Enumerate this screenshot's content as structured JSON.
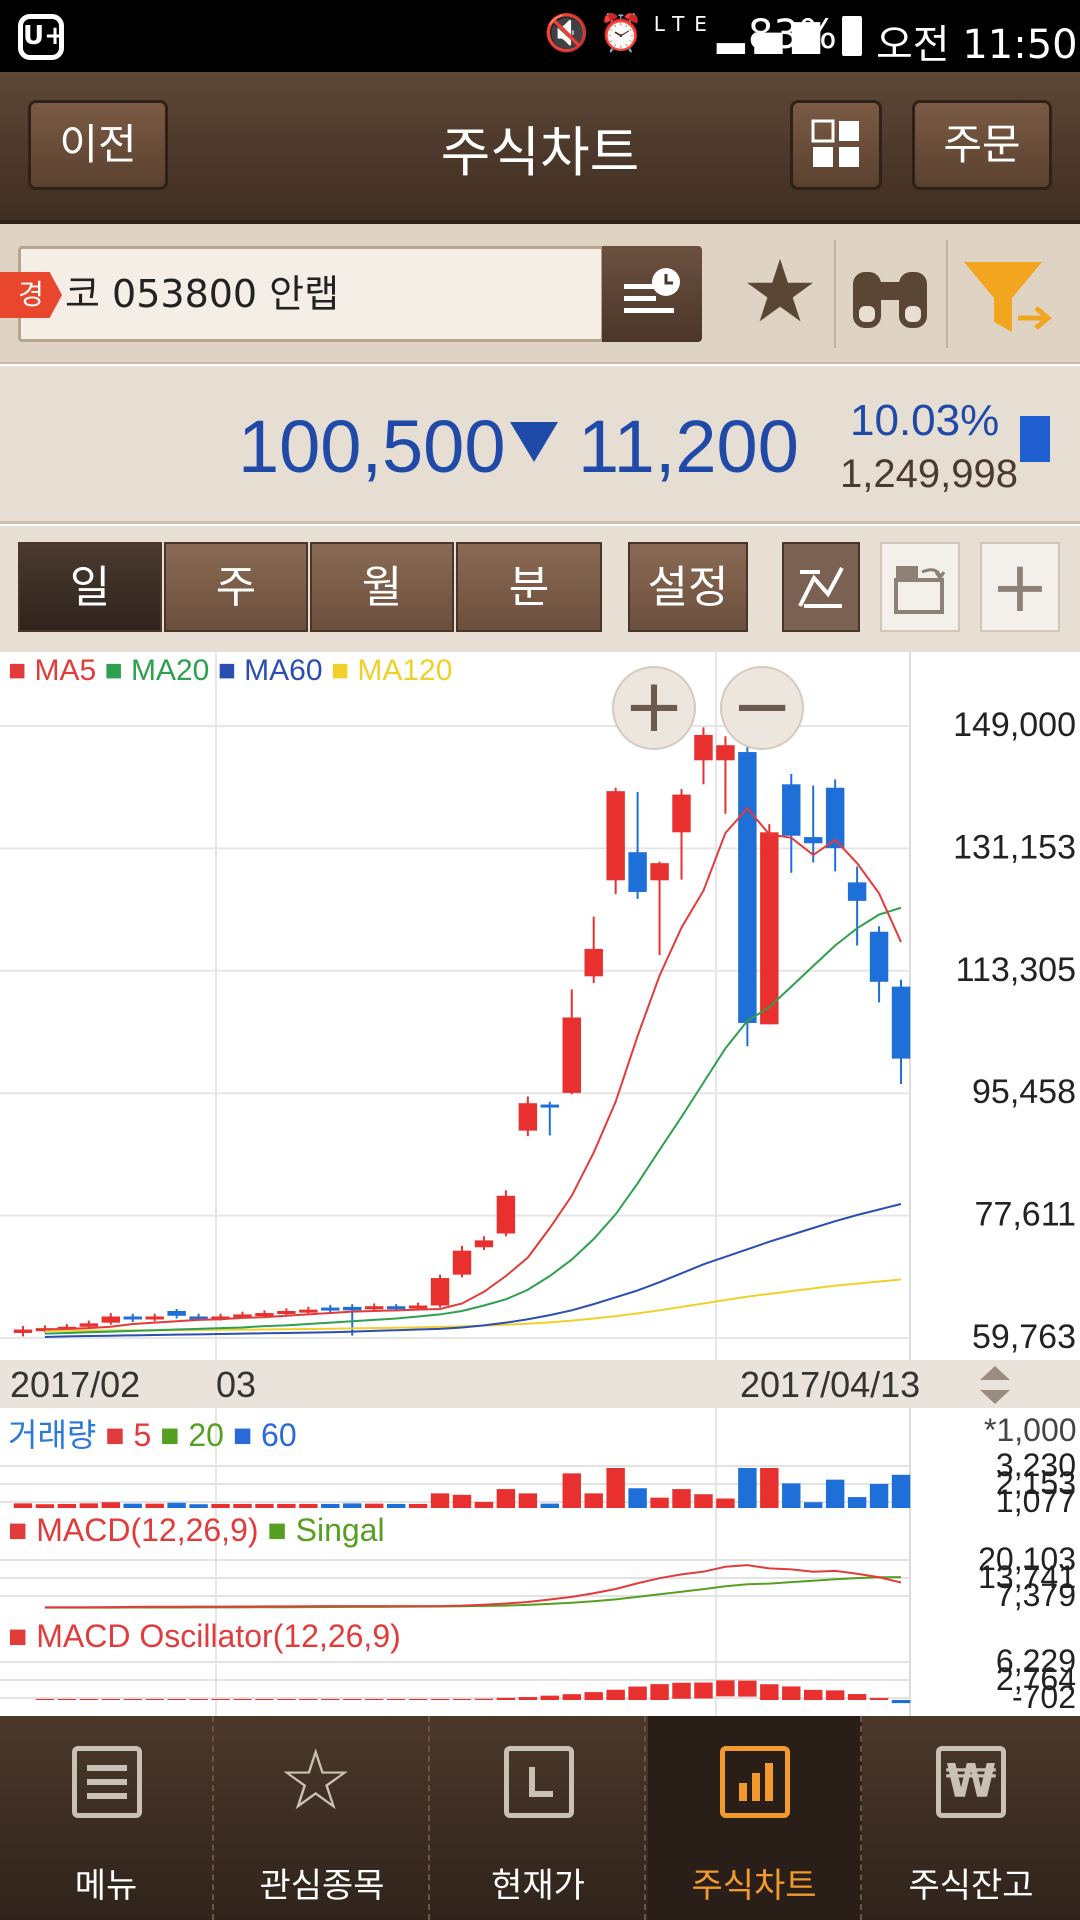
{
  "status_bar": {
    "carrier_logo": "U+",
    "network": "LTE",
    "battery": "83%",
    "time": "오전 11:50"
  },
  "header": {
    "back_label": "이전",
    "title": "주식차트",
    "order_label": "주문"
  },
  "search": {
    "warn_badge": "경",
    "stock_value": "코 053800 안랩"
  },
  "quote": {
    "price": "100,500",
    "change": "11,200",
    "change_pct": "10.03%",
    "volume": "1,249,998",
    "direction": "down",
    "color": "#1f4aa8"
  },
  "periods": {
    "day": "일",
    "week": "주",
    "month": "월",
    "minute": "분",
    "settings": "설정"
  },
  "legend": {
    "ma5": "MA5",
    "ma20": "MA20",
    "ma60": "MA60",
    "ma120": "MA120"
  },
  "dates": {
    "start": "2017/02",
    "mid": "03",
    "end": "2017/04/13"
  },
  "volume_legend": {
    "label": "거래량",
    "p5": "5",
    "p20": "20",
    "p60": "60",
    "unit": "*1,000"
  },
  "macd_legend": {
    "macd": "MACD(12,26,9)",
    "signal": "Singal"
  },
  "osc_legend": {
    "label": "MACD Oscillator(12,26,9)"
  },
  "chart_data": {
    "type": "candlestick",
    "y_ticks": [
      "149,000",
      "131,153",
      "113,305",
      "95,458",
      "77,611",
      "59,763"
    ],
    "ylim": [
      59763,
      149000
    ],
    "candles": [
      {
        "o": 60500,
        "c": 61000,
        "h": 61500,
        "l": 60000,
        "up": true
      },
      {
        "o": 61000,
        "c": 61200,
        "h": 61600,
        "l": 60600,
        "up": true
      },
      {
        "o": 61100,
        "c": 61400,
        "h": 61800,
        "l": 60800,
        "up": true
      },
      {
        "o": 61400,
        "c": 61900,
        "h": 62300,
        "l": 61100,
        "up": true
      },
      {
        "o": 62000,
        "c": 62900,
        "h": 63400,
        "l": 61700,
        "up": true
      },
      {
        "o": 62900,
        "c": 62500,
        "h": 63300,
        "l": 62100,
        "up": false
      },
      {
        "o": 62500,
        "c": 62900,
        "h": 63300,
        "l": 62200,
        "up": true
      },
      {
        "o": 63700,
        "c": 63000,
        "h": 64000,
        "l": 62600,
        "up": false
      },
      {
        "o": 62900,
        "c": 62700,
        "h": 63300,
        "l": 62300,
        "up": false
      },
      {
        "o": 62600,
        "c": 62900,
        "h": 63300,
        "l": 62300,
        "up": true
      },
      {
        "o": 62900,
        "c": 63200,
        "h": 63600,
        "l": 62600,
        "up": true
      },
      {
        "o": 63100,
        "c": 63400,
        "h": 63800,
        "l": 62800,
        "up": true
      },
      {
        "o": 63400,
        "c": 63700,
        "h": 64100,
        "l": 63100,
        "up": true
      },
      {
        "o": 63600,
        "c": 63900,
        "h": 64300,
        "l": 63300,
        "up": true
      },
      {
        "o": 64200,
        "c": 63900,
        "h": 64600,
        "l": 63500,
        "up": false
      },
      {
        "o": 64300,
        "c": 63800,
        "h": 64700,
        "l": 60100,
        "up": false
      },
      {
        "o": 64000,
        "c": 64400,
        "h": 64800,
        "l": 63700,
        "up": true
      },
      {
        "o": 64400,
        "c": 64100,
        "h": 64700,
        "l": 63800,
        "up": false
      },
      {
        "o": 64200,
        "c": 64500,
        "h": 64900,
        "l": 63900,
        "up": true
      },
      {
        "o": 64500,
        "c": 68500,
        "h": 69000,
        "l": 64200,
        "up": true
      },
      {
        "o": 69000,
        "c": 72500,
        "h": 73200,
        "l": 68600,
        "up": true
      },
      {
        "o": 73000,
        "c": 74000,
        "h": 74600,
        "l": 72600,
        "up": true
      },
      {
        "o": 75000,
        "c": 80500,
        "h": 81300,
        "l": 74600,
        "up": true
      },
      {
        "o": 90000,
        "c": 94000,
        "h": 95000,
        "l": 89200,
        "up": true
      },
      {
        "o": 93800,
        "c": 93400,
        "h": 94200,
        "l": 89300,
        "up": false
      },
      {
        "o": 95500,
        "c": 106500,
        "h": 110600,
        "l": 95300,
        "up": true
      },
      {
        "o": 112500,
        "c": 116500,
        "h": 121200,
        "l": 111500,
        "up": true
      },
      {
        "o": 126500,
        "c": 139500,
        "h": 140000,
        "l": 124500,
        "up": true
      },
      {
        "o": 130600,
        "c": 124800,
        "h": 139400,
        "l": 123800,
        "up": false
      },
      {
        "o": 126500,
        "c": 129000,
        "h": 129200,
        "l": 115600,
        "up": true
      },
      {
        "o": 133500,
        "c": 139000,
        "h": 139800,
        "l": 126600,
        "up": true
      },
      {
        "o": 144000,
        "c": 147700,
        "h": 148800,
        "l": 140500,
        "up": true
      },
      {
        "o": 144000,
        "c": 146200,
        "h": 147500,
        "l": 136200,
        "up": true
      },
      {
        "o": 145200,
        "c": 105700,
        "h": 147200,
        "l": 102300,
        "up": false
      },
      {
        "o": 105500,
        "c": 133500,
        "h": 134700,
        "l": 105500,
        "up": true
      },
      {
        "o": 140500,
        "c": 133000,
        "h": 142000,
        "l": 127600,
        "up": false
      },
      {
        "o": 132800,
        "c": 131900,
        "h": 140300,
        "l": 129100,
        "up": false
      },
      {
        "o": 140000,
        "c": 131200,
        "h": 141200,
        "l": 127800,
        "up": false
      },
      {
        "o": 126200,
        "c": 123500,
        "h": 128500,
        "l": 117000,
        "up": false
      },
      {
        "o": 119000,
        "c": 111700,
        "h": 119800,
        "l": 108700,
        "up": false
      },
      {
        "o": 111000,
        "c": 100500,
        "h": 112000,
        "l": 96800,
        "up": false
      }
    ],
    "ma5": [
      61000,
      61100,
      61200,
      61400,
      61800,
      62000,
      62200,
      62400,
      62500,
      62700,
      62800,
      63000,
      63200,
      63400,
      63600,
      63700,
      63800,
      63900,
      64000,
      64800,
      66500,
      68800,
      71500,
      75800,
      80500,
      86800,
      94200,
      103800,
      112600,
      119600,
      125000,
      133400,
      137000,
      133200,
      132700,
      130200,
      132400,
      129000,
      124600,
      117500
    ],
    "ma20": [
      60400,
      60500,
      60600,
      60700,
      60800,
      60900,
      61000,
      61100,
      61200,
      61300,
      61500,
      61600,
      61800,
      62000,
      62200,
      62400,
      62600,
      62900,
      63200,
      63700,
      64500,
      65400,
      66800,
      68800,
      71200,
      74200,
      77800,
      82300,
      87200,
      92000,
      97000,
      102000,
      106000,
      108000,
      111000,
      114000,
      117000,
      119500,
      121500,
      122500
    ],
    "ma60": [
      59900,
      60000,
      60050,
      60100,
      60150,
      60200,
      60250,
      60300,
      60350,
      60400,
      60450,
      60500,
      60550,
      60600,
      60700,
      60800,
      60900,
      61000,
      61100,
      61300,
      61600,
      62000,
      62500,
      63100,
      63800,
      64700,
      65700,
      66700,
      67900,
      69200,
      70500,
      71600,
      72700,
      73800,
      74800,
      75800,
      76800,
      77700,
      78500,
      79300
    ],
    "ma120": [
      60800,
      60820,
      60840,
      60860,
      60880,
      60900,
      60920,
      60940,
      60960,
      60980,
      61000,
      61040,
      61080,
      61120,
      61160,
      61200,
      61260,
      61320,
      61380,
      61460,
      61560,
      61700,
      61860,
      62050,
      62300,
      62600,
      62950,
      63350,
      63800,
      64300,
      64800,
      65300,
      65800,
      66200,
      66600,
      67000,
      67400,
      67700,
      68000,
      68300
    ],
    "volume_ticks": [
      "3,230",
      "2,153",
      "1,077"
    ],
    "macd_ticks": [
      "20,103",
      "13,741",
      "7,379"
    ],
    "osc_ticks": [
      "6,229",
      "2,764",
      "-702"
    ]
  },
  "nav": {
    "menu": "메뉴",
    "watchlist": "관심종목",
    "current": "현재가",
    "chart": "주식차트",
    "balance": "주식잔고"
  }
}
